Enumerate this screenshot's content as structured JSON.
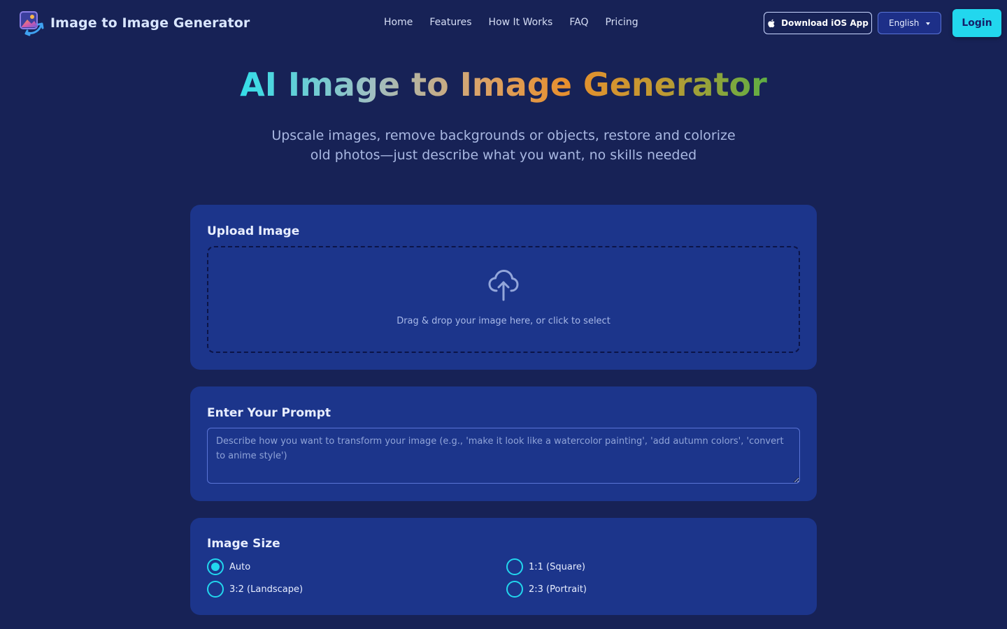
{
  "header": {
    "brand_name": "Image to Image Generator",
    "nav": [
      {
        "label": "Home"
      },
      {
        "label": "Features"
      },
      {
        "label": "How It Works"
      },
      {
        "label": "FAQ"
      },
      {
        "label": "Pricing"
      }
    ],
    "ios_button_label": "Download iOS App",
    "language_selected": "English",
    "login_label": "Login"
  },
  "hero": {
    "title": "AI Image to Image Generator",
    "subtitle": "Upscale images, remove backgrounds or objects, restore and colorize old photos—just describe what you want, no skills needed"
  },
  "upload": {
    "title": "Upload Image",
    "dropzone_text": "Drag & drop your image here, or click to select"
  },
  "prompt": {
    "title": "Enter Your Prompt",
    "value": "",
    "placeholder": "Describe how you want to transform your image (e.g., 'make it look like a watercolor painting', 'add autumn colors', 'convert to anime style')"
  },
  "image_size": {
    "title": "Image Size",
    "options": [
      {
        "label": "Auto",
        "selected": true
      },
      {
        "label": "1:1 (Square)",
        "selected": false
      },
      {
        "label": "3:2 (Landscape)",
        "selected": false
      },
      {
        "label": "2:3 (Portrait)",
        "selected": false
      }
    ]
  },
  "colors": {
    "background": "#172256",
    "card": "#1c358b",
    "accent": "#22d7ee"
  },
  "icons": {
    "logo": "image-swap-icon",
    "apple": "apple-icon",
    "language_caret": "caret-down-icon",
    "upload": "cloud-upload-icon"
  }
}
